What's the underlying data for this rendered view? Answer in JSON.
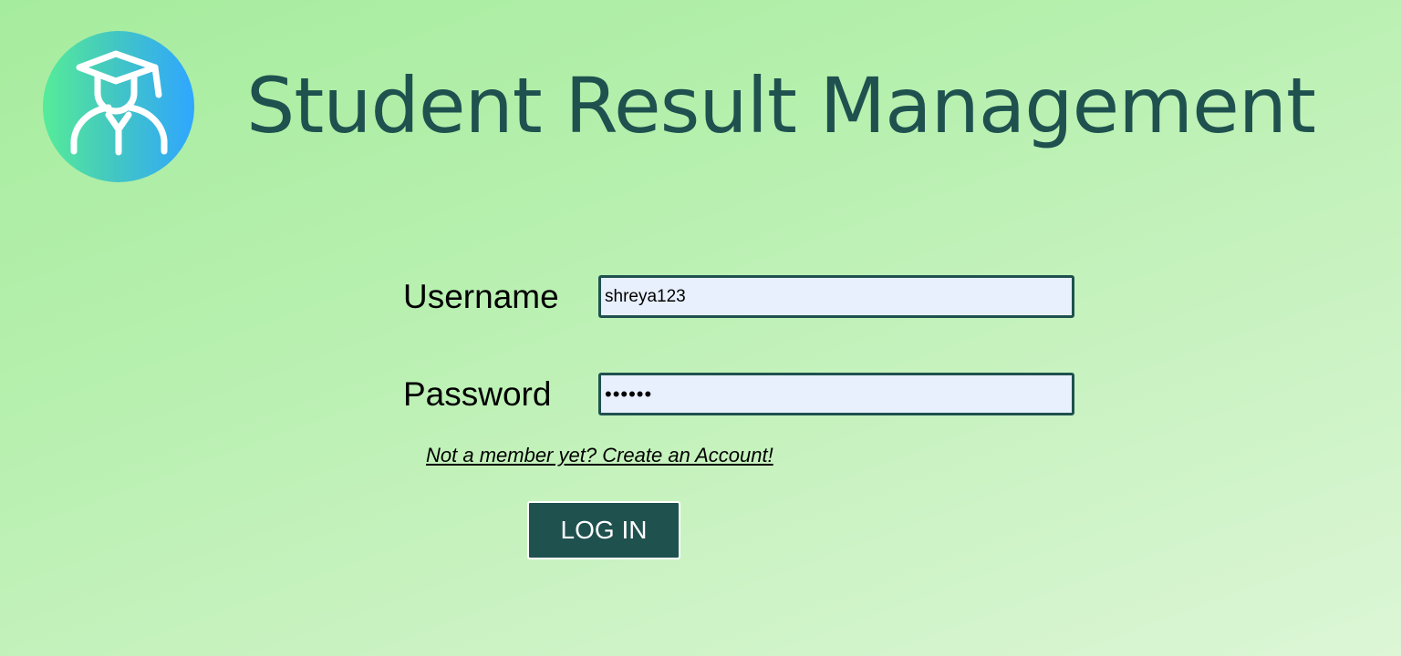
{
  "header": {
    "logo_icon": "student-graduate-icon",
    "title": "Student Result Management"
  },
  "login_form": {
    "username": {
      "label": "Username",
      "value": "shreya123"
    },
    "password": {
      "label": "Password",
      "value": "secret"
    },
    "signup_link": "Not a member yet? Create an Account!",
    "login_button": "LOG IN"
  },
  "colors": {
    "primary": "#1f514f",
    "input_background": "#e8f0fe",
    "logo_gradient_start": "#55ec98",
    "logo_gradient_end": "#2fa6ff"
  }
}
